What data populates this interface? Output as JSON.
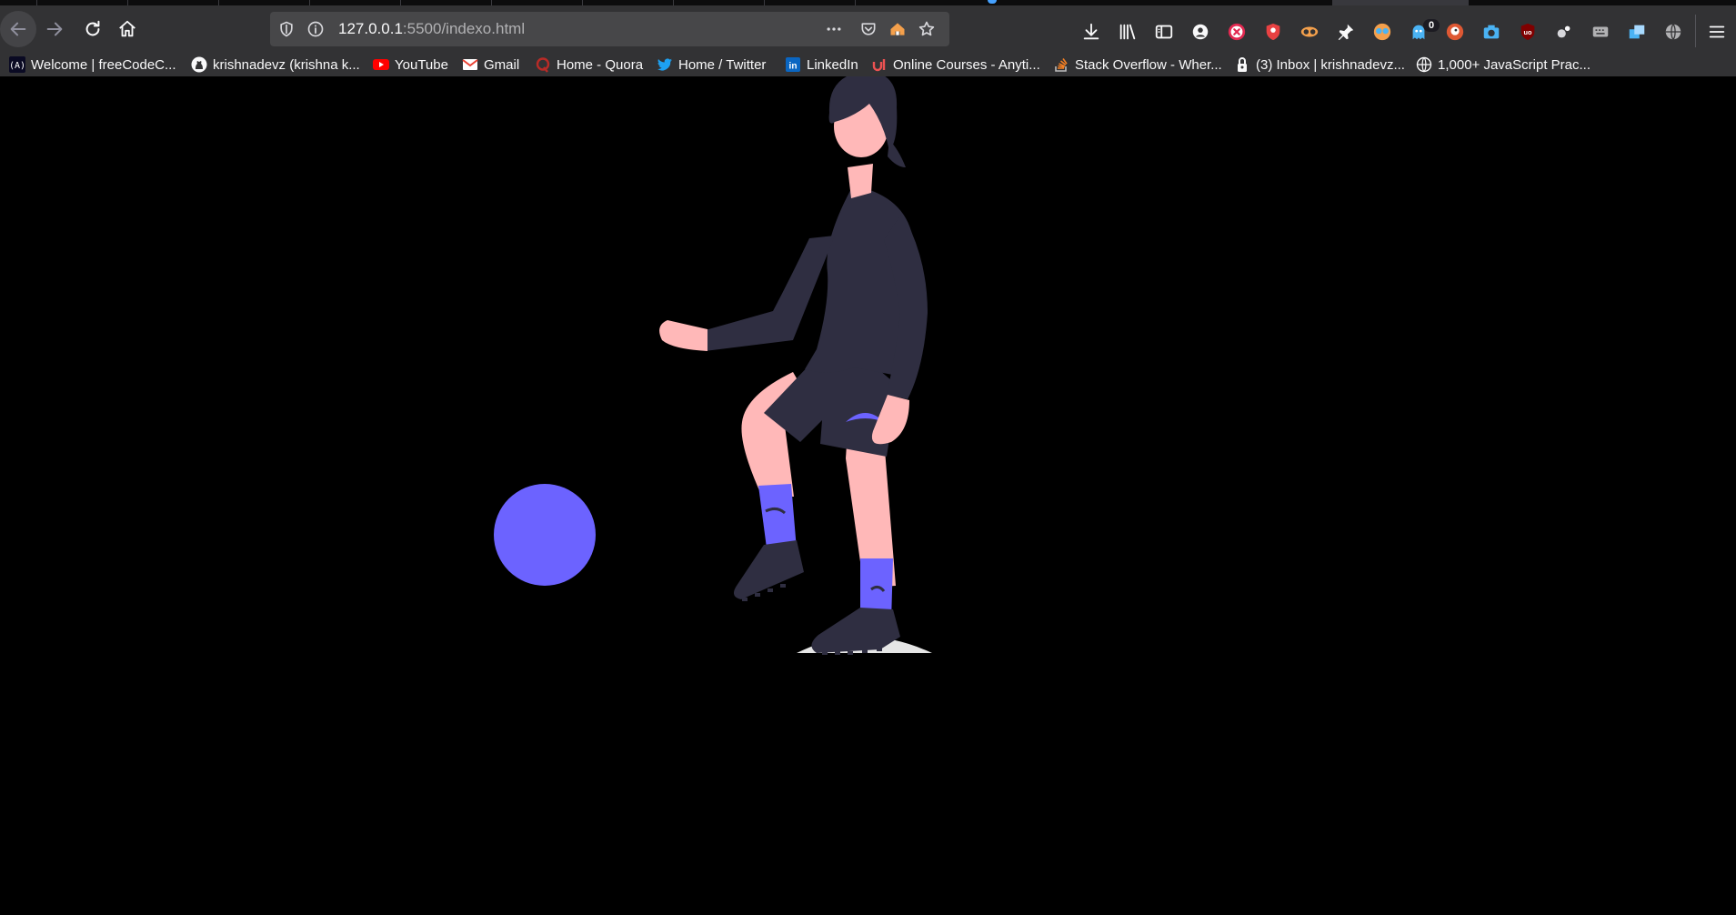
{
  "browser": {
    "url_host": "127.0.0.1",
    "url_rest": ":5500/indexo.html",
    "extension_badge": "0",
    "icons": [
      "back-arrow-icon",
      "forward-arrow-icon",
      "reload-icon",
      "home-icon",
      "shield-icon",
      "info-icon",
      "more-dots-icon",
      "pocket-icon",
      "home-page-icon",
      "star-icon",
      "download-icon",
      "library-icon",
      "sidebar-icon",
      "account-icon",
      "menu-icon"
    ]
  },
  "bookmarks": [
    {
      "label": "Welcome | freeCodeC...",
      "icon": "freecodecamp-icon"
    },
    {
      "label": "krishnadevz (krishna k...",
      "icon": "github-icon"
    },
    {
      "label": "YouTube",
      "icon": "youtube-icon"
    },
    {
      "label": "Gmail",
      "icon": "gmail-icon"
    },
    {
      "label": "Home - Quora",
      "icon": "quora-icon"
    },
    {
      "label": "Home / Twitter",
      "icon": "twitter-icon"
    },
    {
      "label": "LinkedIn",
      "icon": "linkedin-icon"
    },
    {
      "label": "Online Courses - Anyti...",
      "icon": "udemy-icon"
    },
    {
      "label": "Stack Overflow - Wher...",
      "icon": "stackoverflow-icon"
    },
    {
      "label": "(3) Inbox | krishnadevz...",
      "icon": "protonmail-icon"
    },
    {
      "label": "1,000+ JavaScript Prac...",
      "icon": "globe-icon"
    }
  ],
  "colors": {
    "background": "#000000",
    "chrome": "#323234",
    "urlbar": "#474749",
    "accent": "#6c63ff",
    "skin": "#ffb8b8",
    "clothing": "#2f2e41",
    "ground": "#e6e6e6"
  },
  "illustration": {
    "subject": "soccer player kicking a ball"
  }
}
